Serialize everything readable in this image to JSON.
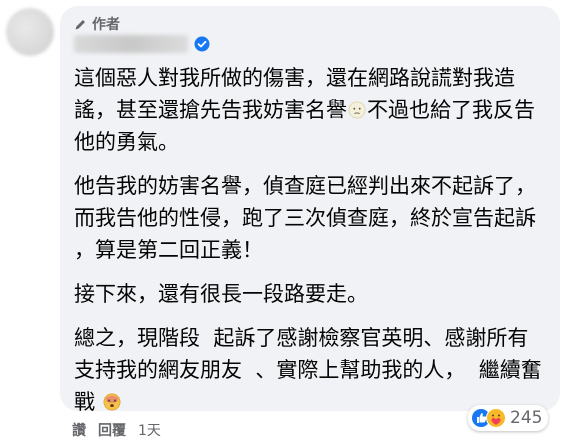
{
  "comment": {
    "author_badge": "作者",
    "paragraphs": [
      {
        "text": "這個惡人對我所做的傷害，還在網路說謊對我造謠，甚至還搶先告我妨害名譽",
        "after_emoji": "不過也給了我反告他的勇氣。"
      },
      {
        "text": "他告我的妨害名譽，偵查庭已經判出來不起訴了，而我告他的性侵，跑了三次偵查庭，終於宣告起訴 ，算是第二回正義！"
      },
      {
        "text": "接下來，還有很長一段路要走。"
      },
      {
        "text": "總之，現階段  起訴了感謝檢察官英明、感謝所有支持我的網友朋友  、實際上幫助我的人，  繼續奮戰 "
      }
    ],
    "reaction_count": "245",
    "actions": {
      "like": "讚",
      "reply": "回覆",
      "time": "1天"
    }
  },
  "icons": {
    "author": "pen-icon",
    "verified": "verified-badge-icon",
    "emoji1": "pale-face-emoji-icon",
    "emoji2": "dizzy-face-emoji-icon",
    "reactions": [
      "like-reaction-icon",
      "care-reaction-icon"
    ]
  },
  "colors": {
    "bubble": "#f0f2f5",
    "verified": "#1877f2",
    "meta_text": "#65676b",
    "like_blue": "#1877f2",
    "care_yellow": "#f7b928"
  }
}
